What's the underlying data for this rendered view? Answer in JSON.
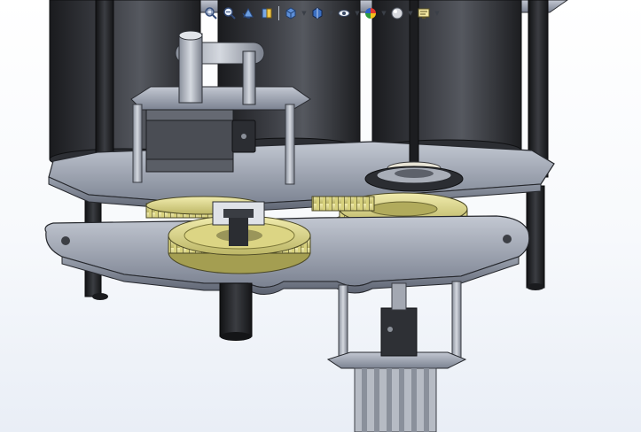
{
  "window": {
    "background": "#f7f9fc"
  },
  "heads_up_toolbar": {
    "buttons": [
      {
        "name": "zoom-to-fit",
        "icon": "zoom-to-fit-icon",
        "dropdown": false
      },
      {
        "name": "zoom-to-area",
        "icon": "zoom-to-area-icon",
        "dropdown": false
      },
      {
        "name": "previous-view",
        "icon": "previous-view-icon",
        "dropdown": false
      },
      {
        "name": "section-view",
        "icon": "section-view-icon",
        "dropdown": false
      },
      {
        "name": "view-orientation",
        "icon": "view-orientation-cube-icon",
        "dropdown": true
      },
      {
        "name": "display-style",
        "icon": "shaded-with-edges-icon",
        "dropdown": true
      },
      {
        "name": "hide-show-items",
        "icon": "hide-show-eye-icon",
        "dropdown": true
      },
      {
        "name": "edit-appearance",
        "icon": "appearance-color-wheel-icon",
        "dropdown": true
      },
      {
        "name": "apply-scene",
        "icon": "scene-icon",
        "dropdown": true
      },
      {
        "name": "view-settings",
        "icon": "view-settings-monitor-icon",
        "dropdown": true
      }
    ]
  },
  "model": {
    "description_colors": {
      "motor": "#2a2c30",
      "plate": "#8f96a5",
      "gear": "#e3dd8c",
      "shaft": "#1d1f22",
      "coupler": "#33353a"
    }
  }
}
